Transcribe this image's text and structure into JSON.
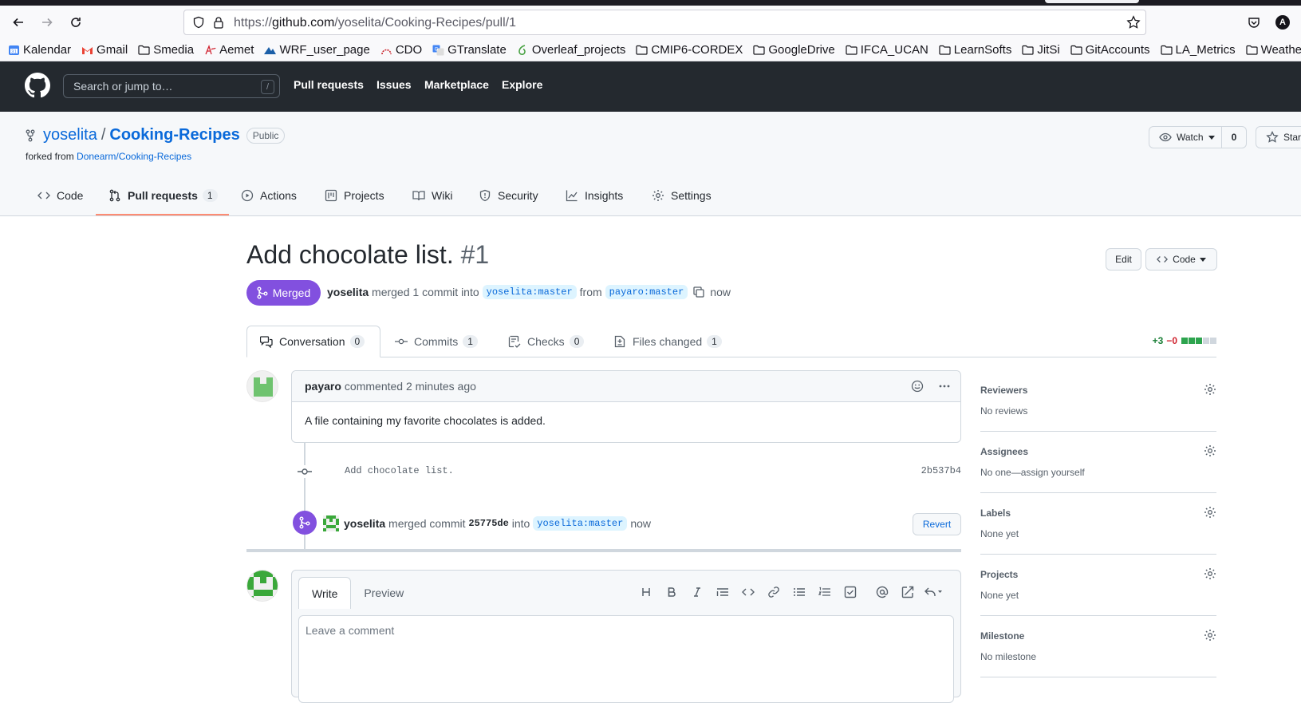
{
  "browser": {
    "url_prefix": "https://",
    "url_host": "github.com",
    "url_path": "/yoselita/Cooking-Recipes/pull/1",
    "profile_initial": "A",
    "bookmarks": [
      {
        "label": "Kalendar",
        "icon": "calendar-icon"
      },
      {
        "label": "Gmail",
        "icon": "gmail-icon"
      },
      {
        "label": "Smedia",
        "icon": "folder-icon"
      },
      {
        "label": "Aemet",
        "icon": "aemet-icon"
      },
      {
        "label": "WRF_user_page",
        "icon": "wrf-icon"
      },
      {
        "label": "CDO",
        "icon": "cdo-icon"
      },
      {
        "label": "GTranslate",
        "icon": "translate-icon"
      },
      {
        "label": "Overleaf_projects",
        "icon": "overleaf-icon"
      },
      {
        "label": "CMIP6-CORDEX",
        "icon": "folder-icon"
      },
      {
        "label": "GoogleDrive",
        "icon": "folder-icon"
      },
      {
        "label": "IFCA_UCAN",
        "icon": "folder-icon"
      },
      {
        "label": "LearnSofts",
        "icon": "folder-icon"
      },
      {
        "label": "JitSi",
        "icon": "folder-icon"
      },
      {
        "label": "GitAccounts",
        "icon": "folder-icon"
      },
      {
        "label": "LA_Metrics",
        "icon": "folder-icon"
      },
      {
        "label": "Weather",
        "icon": "folder-icon"
      }
    ]
  },
  "github": {
    "search_placeholder": "Search or jump to…",
    "search_shortcut": "/",
    "nav": [
      "Pull requests",
      "Issues",
      "Marketplace",
      "Explore"
    ]
  },
  "repo": {
    "owner": "yoselita",
    "separator": "/",
    "name": "Cooking-Recipes",
    "visibility": "Public",
    "forked_prefix": "forked from ",
    "forked_from": "Donearm/Cooking-Recipes",
    "watch_label": "Watch",
    "watch_count": "0",
    "star_label": "Star",
    "tabs": [
      {
        "label": "Code",
        "count": ""
      },
      {
        "label": "Pull requests",
        "count": "1"
      },
      {
        "label": "Actions",
        "count": ""
      },
      {
        "label": "Projects",
        "count": ""
      },
      {
        "label": "Wiki",
        "count": ""
      },
      {
        "label": "Security",
        "count": ""
      },
      {
        "label": "Insights",
        "count": ""
      },
      {
        "label": "Settings",
        "count": ""
      }
    ]
  },
  "pr": {
    "title": "Add chocolate list.",
    "number": "#1",
    "edit_label": "Edit",
    "code_label": "Code",
    "state": "Merged",
    "merger": "yoselita",
    "merge_text": "merged 1 commit into",
    "base_branch": "yoselita:master",
    "from_text": "from",
    "head_branch": "payaro:master",
    "merge_time": "now",
    "tabs": [
      {
        "label": "Conversation",
        "count": "0"
      },
      {
        "label": "Commits",
        "count": "1"
      },
      {
        "label": "Checks",
        "count": "0"
      },
      {
        "label": "Files changed",
        "count": "1"
      }
    ],
    "additions": "+3",
    "deletions": "−0",
    "diff_blocks": [
      "added",
      "added",
      "added",
      "neutral",
      "neutral"
    ]
  },
  "colors": {
    "merged": "#8250df",
    "link": "#0969da",
    "added": "#2da44e",
    "deleted": "#cf222e",
    "tab_underline": "#fd8c73"
  },
  "comment": {
    "author": "payaro",
    "action": "commented",
    "time": "2 minutes ago",
    "body": "A file containing my favorite chocolates is added."
  },
  "commit": {
    "message": "Add chocolate list.",
    "sha": "2b537b4"
  },
  "merge_event": {
    "user": "yoselita",
    "text": "merged commit",
    "sha": "25775de",
    "into": "into",
    "branch": "yoselita:master",
    "time": "now",
    "revert_label": "Revert"
  },
  "editor": {
    "write_tab": "Write",
    "preview_tab": "Preview",
    "placeholder": "Leave a comment",
    "toolbar": [
      "heading-icon",
      "bold-icon",
      "italic-icon",
      "quote-icon",
      "code-icon",
      "link-icon",
      "bulleted-list-icon",
      "numbered-list-icon",
      "task-list-icon",
      "mention-icon",
      "cross-reference-icon",
      "saved-reply-icon"
    ]
  },
  "sidebar": [
    {
      "title": "Reviewers",
      "value": "No reviews"
    },
    {
      "title": "Assignees",
      "value": "No one—assign yourself"
    },
    {
      "title": "Labels",
      "value": "None yet"
    },
    {
      "title": "Projects",
      "value": "None yet"
    },
    {
      "title": "Milestone",
      "value": "No milestone"
    }
  ]
}
